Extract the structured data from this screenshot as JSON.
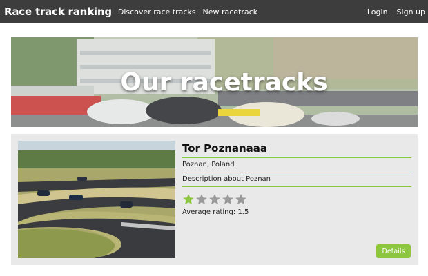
{
  "nav": {
    "brand": "Race track ranking",
    "links": [
      "Discover race tracks",
      "New racetrack"
    ],
    "login": "Login",
    "signup": "Sign up"
  },
  "hero": {
    "title": "Our racetracks"
  },
  "tracks": [
    {
      "name": "Tor Poznanaaa",
      "location": "Poznan, Poland",
      "description": "Description about Poznan",
      "rating_stars": 1,
      "rating_max": 5,
      "average_label": "Average rating: 1.5",
      "details_label": "Details"
    }
  ],
  "colors": {
    "navbar": "#3d3d3d",
    "accent": "#8dc63f",
    "card_bg": "#e9e9e9",
    "star_filled": "#8dc63f",
    "star_empty": "#9a9a9a"
  }
}
